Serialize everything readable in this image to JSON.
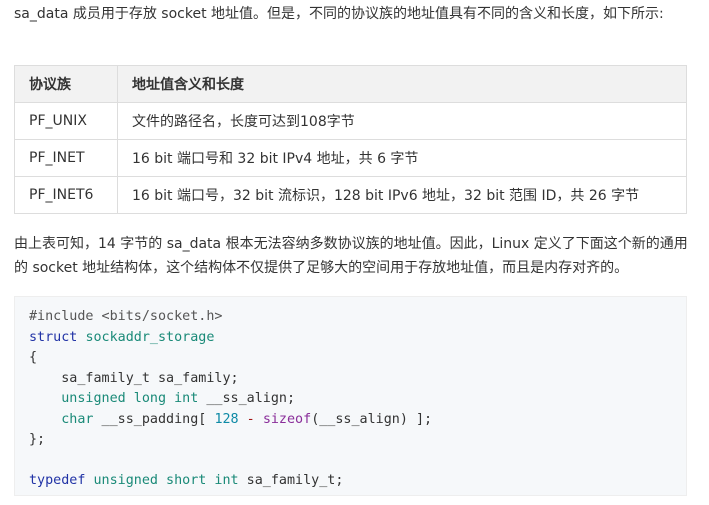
{
  "intro_paragraph": "sa_data 成员用于存放 socket 地址值。但是，不同的协议族的地址值具有不同的含义和长度，如下所示:",
  "table": {
    "headers": [
      "协议族",
      "地址值含义和长度"
    ],
    "rows": [
      [
        "PF_UNIX",
        "文件的路径名，长度可达到108字节"
      ],
      [
        "PF_INET",
        "16 bit 端口号和 32 bit IPv4 地址，共 6 字节"
      ],
      [
        "PF_INET6",
        "16 bit 端口号，32 bit 流标识，128 bit IPv6 地址，32 bit 范围 ID，共 26 字节"
      ]
    ]
  },
  "second_paragraph": "由上表可知，14 字节的 sa_data 根本无法容纳多数协议族的地址值。因此，Linux 定义了下面这个新的通用的 socket 地址结构体，这个结构体不仅提供了足够大的空间用于存放地址值，而且是内存对齐的。",
  "code": {
    "include": "#include <bits/socket.h>",
    "struct_kw": "struct",
    "struct_name": "sockaddr_storage",
    "open_brace": "{",
    "field1": "    sa_family_t sa_family;",
    "field2_type": "unsigned long int",
    "field2_name": " __ss_align;",
    "field3_type": "char",
    "field3_rest_a": " __ss_padding[ ",
    "field3_num": "128",
    "field3_op": " - ",
    "field3_fn": "sizeof",
    "field3_rest_b": "(__ss_align) ];",
    "close_brace": "};",
    "typedef_kw": "typedef",
    "typedef_type": "unsigned short int",
    "typedef_name": " sa_family_t;"
  }
}
